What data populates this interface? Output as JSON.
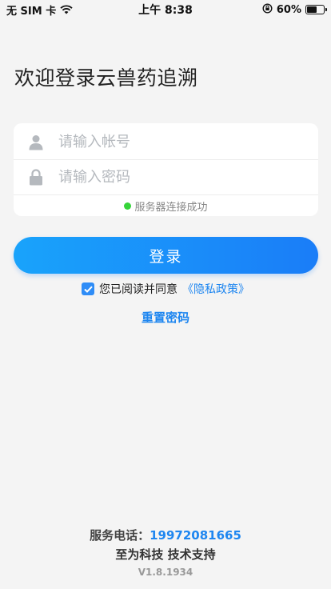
{
  "status_bar": {
    "carrier": "无 SIM 卡",
    "time": "上午 8:38",
    "battery_text": "60%",
    "battery_level": 0.6
  },
  "welcome": {
    "title": "欢迎登录云兽药追溯"
  },
  "form": {
    "account_placeholder": "请输入帐号",
    "password_placeholder": "请输入密码",
    "connection_status": "服务器连接成功",
    "status_color": "#36d43a"
  },
  "login_button": {
    "label": "登录"
  },
  "agreement": {
    "text": "您已阅读并同意",
    "policy_link": "《隐私政策》",
    "checked": true
  },
  "reset_password": {
    "label": "重置密码"
  },
  "footer": {
    "phone_label": "服务电话：",
    "phone_number": "19972081665",
    "support": "至为科技 技术支持",
    "version": "V1.8.1934"
  },
  "colors": {
    "accent": "#1e86f0",
    "button_gradient_start": "#19a3fb",
    "button_gradient_end": "#1a7df8",
    "background": "#f4f4f4"
  },
  "icons": [
    "wifi-icon",
    "rotation-lock-icon",
    "battery-icon",
    "user-icon",
    "lock-icon",
    "checkmark-icon"
  ]
}
